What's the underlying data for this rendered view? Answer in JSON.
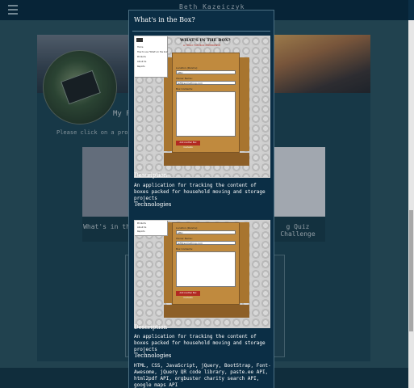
{
  "header": {
    "site_title": "Beth Kazeiczyk",
    "menu_icon": "hamburger-icon"
  },
  "background": {
    "heading": "My Po",
    "subheading": "Please click on a project card s",
    "cards": [
      {
        "caption": "What's in th"
      },
      {
        "caption": "g Quiz Challenge"
      }
    ]
  },
  "modal": {
    "title": "What's in the Box?",
    "sections": [
      {
        "heading": "Description",
        "body": "An application for tracking the content of boxes packed for household moving and storage projects"
      },
      {
        "heading": "Technologies",
        "body": ""
      },
      {
        "heading": "Description",
        "body": "An application for tracking the content of boxes packed for household moving and storage projects"
      },
      {
        "heading": "Technologies",
        "body": "HTML, CSS, JavaScript, jQuery, BootStrap, Font-Awesome, jQuery QR code library, paste.ee API, html2pdf API, orgbuster charity search API, google maps API"
      }
    ],
    "screenshot": {
      "heading": "WHAT'S IN THE BOX?",
      "subheading": "A TRULY FUN BOX EXPERIENCE",
      "menu_items": [
        "Home",
        "How to use 'What's in the box'",
        "Products",
        "About Us",
        "Reports"
      ],
      "fields": [
        {
          "label": "Location (Rooms):",
          "value": "Attic"
        },
        {
          "label": "Owner Name:",
          "value": "Jeff@something.com"
        },
        {
          "label": "Box Contents:",
          "value": ""
        }
      ],
      "button": "Add Another Box Contents"
    }
  }
}
